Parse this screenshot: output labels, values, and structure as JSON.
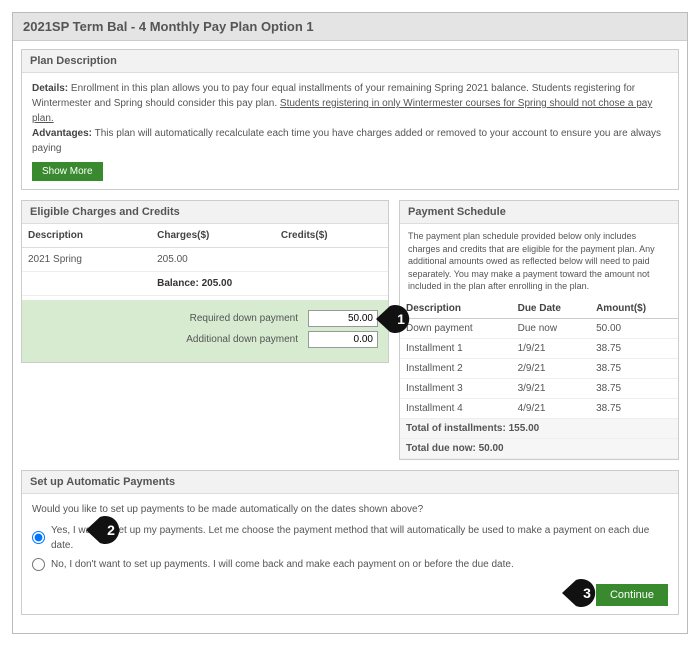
{
  "title": "2021SP Term Bal - 4 Monthly Pay Plan Option 1",
  "plan_desc": {
    "header": "Plan Description",
    "details_label": "Details:",
    "details_text": " Enrollment in this plan allows you to pay four equal installments of your remaining Spring  2021 balance.  Students registering for Wintermester and Spring should consider this pay plan.  ",
    "details_underline": "Students registering in only Wintermester courses for Spring should not chose a pay plan.",
    "adv_label": "Advantages:",
    "adv_text": " This plan will automatically recalculate each time you have charges added or removed to your account to ensure you are always paying",
    "show_more": "Show More"
  },
  "eligible": {
    "header": "Eligible Charges and Credits",
    "cols": {
      "desc": "Description",
      "charges": "Charges($)",
      "credits": "Credits($)"
    },
    "rows": [
      {
        "desc": "2021 Spring",
        "charges": "205.00",
        "credits": ""
      }
    ],
    "balance_label": "Balance:",
    "balance_value": "205.00",
    "req_dp_label": "Required down payment",
    "req_dp_value": "50.00",
    "add_dp_label": "Additional down payment",
    "add_dp_value": "0.00"
  },
  "schedule": {
    "header": "Payment Schedule",
    "desc": "The payment plan schedule provided below only includes charges and credits that are eligible for the payment plan. Any additional amounts owed as reflected below will need to paid separately. You may make a payment toward the amount not included in the plan after enrolling in the plan.",
    "cols": {
      "desc": "Description",
      "due": "Due Date",
      "amt": "Amount($)"
    },
    "rows": [
      {
        "desc": "Down payment",
        "due": "Due now",
        "amt": "50.00"
      },
      {
        "desc": "Installment 1",
        "due": "1/9/21",
        "amt": "38.75"
      },
      {
        "desc": "Installment 2",
        "due": "2/9/21",
        "amt": "38.75"
      },
      {
        "desc": "Installment 3",
        "due": "3/9/21",
        "amt": "38.75"
      },
      {
        "desc": "Installment 4",
        "due": "4/9/21",
        "amt": "38.75"
      }
    ],
    "total_inst_label": "Total of installments:",
    "total_inst_value": "155.00",
    "total_due_label": "Total due now:",
    "total_due_value": "50.00"
  },
  "autopay": {
    "header": "Set up Automatic Payments",
    "question": "Would you like to set up payments to be made automatically on the dates shown above?",
    "yes_pre": "Yes, I want to set up my payments. Let me choose the payment method that will automatically be used to make a payment on each due date.",
    "no_pre": "No, I don't want to set up payments. I will come back and make each payment on or before the due date."
  },
  "continue": "Continue",
  "callouts": {
    "c1": "1",
    "c2": "2",
    "c3": "3"
  }
}
